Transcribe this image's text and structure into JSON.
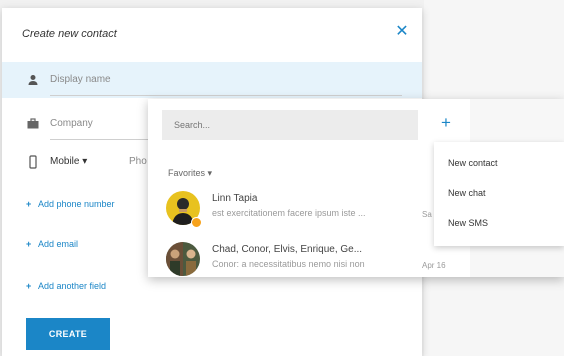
{
  "dialog": {
    "title": "Create new contact",
    "close_icon": "close-icon",
    "fields": {
      "display_name_placeholder": "Display name",
      "company_placeholder": "Company",
      "phone_type": "Mobile",
      "phone_placeholder": "Pho"
    },
    "links": {
      "add_phone": "Add phone number",
      "add_email": "Add email",
      "add_field": "Add another field"
    },
    "create_label": "CREATE",
    "accent": "#1b86c7"
  },
  "chat": {
    "search_placeholder": "Search...",
    "favorites_label": "Favorites",
    "conversations": [
      {
        "name": "Linn Tapia",
        "message": "est exercitationem facere ipsum iste ...",
        "time": "Sa"
      },
      {
        "name": "Chad, Conor, Elvis, Enrique, Ge...",
        "message": "Conor: a necessitatibus nemo nisi non",
        "time": "Apr 16"
      }
    ],
    "status_color": "#f7a21b"
  },
  "menu": {
    "items": [
      "New contact",
      "New chat",
      "New SMS"
    ]
  }
}
